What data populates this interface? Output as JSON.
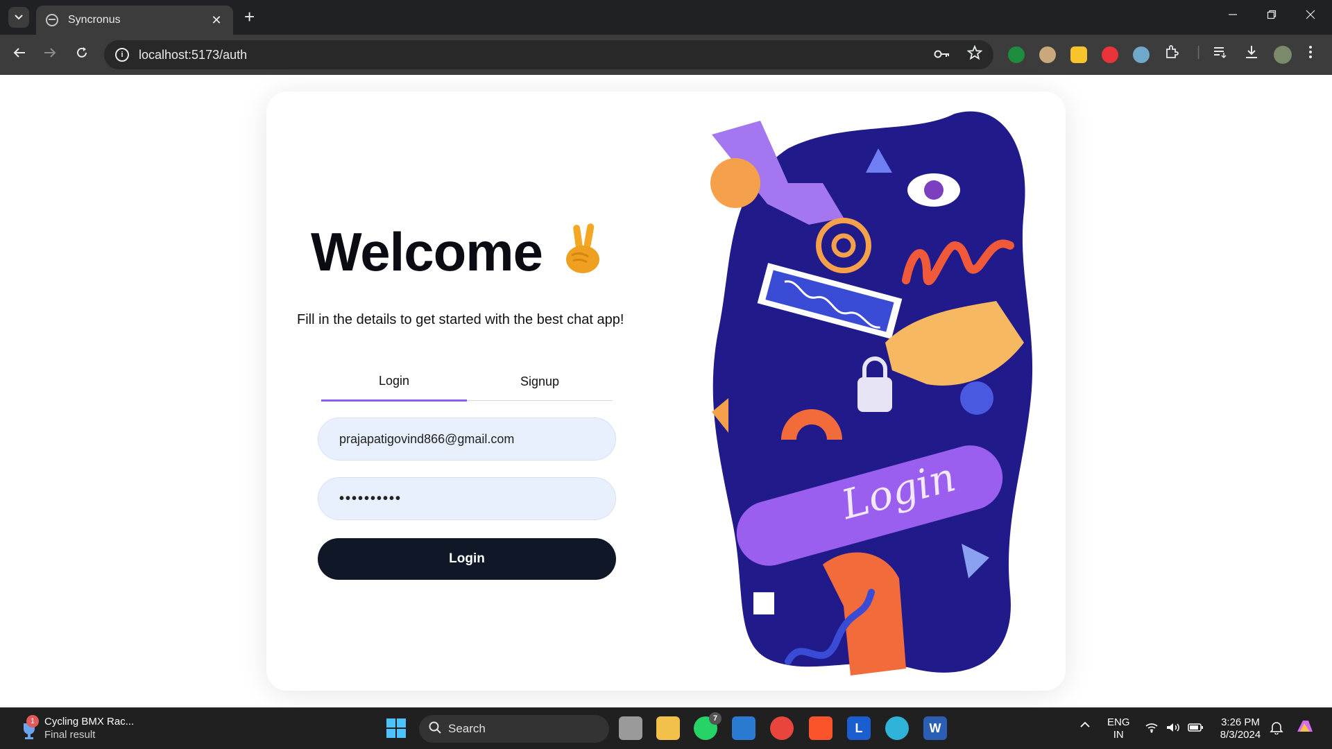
{
  "browser": {
    "tab_title": "Syncronus",
    "url": "localhost:5173/auth",
    "new_tab_symbol": "+",
    "tab_close_symbol": "✕"
  },
  "page": {
    "heading": "Welcome",
    "subtitle": "Fill in the details to get started with the best chat app!",
    "tabs": [
      {
        "label": "Login",
        "active": true
      },
      {
        "label": "Signup",
        "active": false
      }
    ],
    "email_value": "prajapatigovind866@gmail.com",
    "password_value": "••••••••••",
    "submit_label": "Login",
    "illustration_text": "Login",
    "accent_color": "#8b5cf6",
    "button_color": "#101828",
    "input_bg": "#e8effd"
  },
  "taskbar": {
    "notification_title": "Cycling BMX Rac...",
    "notification_sub": "Final result",
    "notification_badge": "1",
    "search_label": "Search",
    "whatsapp_badge": "7",
    "lang_line1": "ENG",
    "lang_line2": "IN",
    "time": "3:26 PM",
    "date": "8/3/2024"
  }
}
